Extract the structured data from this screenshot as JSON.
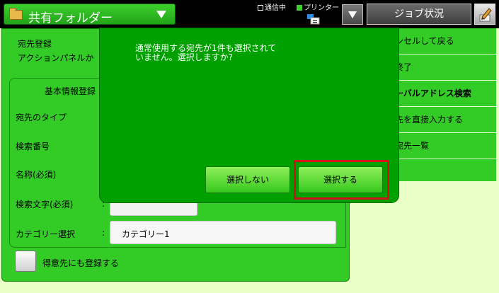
{
  "header": {
    "folder_title": "共有フォルダー",
    "status_comm": "通信中",
    "status_printer": "プリンター",
    "job_button": "ジョブ状況"
  },
  "form": {
    "section_title": "宛先登録",
    "section_sub": "アクションパネルか",
    "tab_label": "基本情報登録",
    "fields": {
      "type": "宛先のタイプ",
      "search_no": "検索番号",
      "name": "名称(必須)",
      "search_text": "検索文字(必須)",
      "category": "カテゴリー選択"
    },
    "colon": ":",
    "category_value": "カテゴリー1",
    "favorite_label": "得意先にも登録する"
  },
  "right_menu": {
    "items": [
      "ンセルして戻る",
      "終了",
      "ーバルアドレス検索",
      "先を直接入力する",
      "宛先一覧"
    ]
  },
  "dialog": {
    "message": "通常使用する宛先が1件も選択されて\nいません。選択しますか?",
    "no_button": "選択しない",
    "yes_button": "選択する"
  },
  "colors": {
    "accent_green": "#33cc26",
    "dialog_green": "#00a000",
    "background": "#eaffc8",
    "highlight_red": "#d0101a"
  }
}
